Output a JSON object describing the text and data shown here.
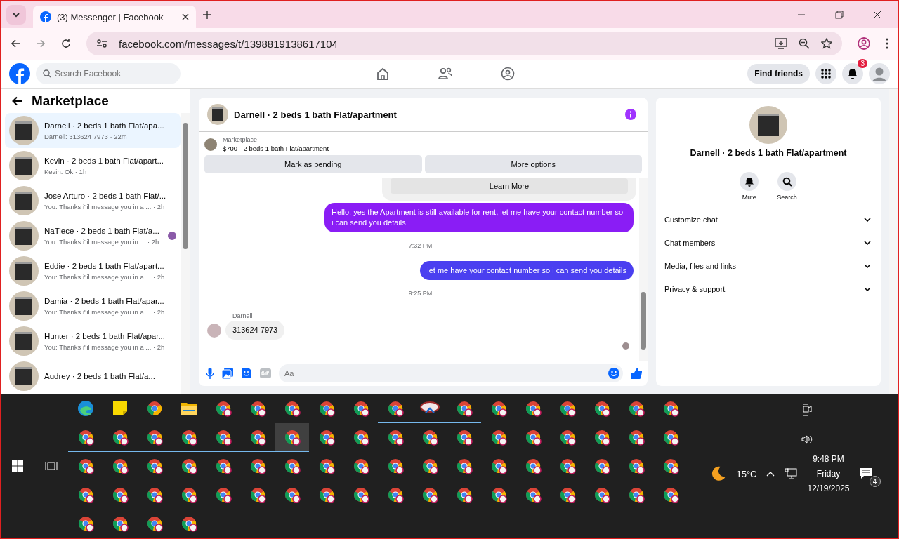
{
  "browser": {
    "tab_title": "(3) Messenger | Facebook",
    "address": "facebook.com/messages/t/1398819138617104"
  },
  "facebook_header": {
    "search_placeholder": "Search Facebook",
    "find_friends": "Find friends",
    "notification_count": "3"
  },
  "sidebar": {
    "title": "Marketplace",
    "items": [
      {
        "title": "Darnell · 2 beds 1 bath Flat/apa...",
        "preview": "Darnell: 313624 7973 · 22m",
        "selected": true,
        "seen": false
      },
      {
        "title": "Kevin · 2 beds 1 bath Flat/apart...",
        "preview": "Kevin: Ok · 1h",
        "selected": false,
        "seen": false
      },
      {
        "title": "Jose Arturo · 2 beds 1 bath Flat/...",
        "preview": "You: Thanks i\"il message you in a ...  · 2h",
        "selected": false,
        "seen": false
      },
      {
        "title": "NaTiece · 2 beds 1 bath Flat/a...",
        "preview": "You: Thanks i\"il message you in ... · 2h",
        "selected": false,
        "seen": true
      },
      {
        "title": "Eddie · 2 beds 1 bath Flat/apart...",
        "preview": "You: Thanks i\"il message you in a ...  · 2h",
        "selected": false,
        "seen": false
      },
      {
        "title": "Damia · 2 beds 1 bath Flat/apar...",
        "preview": "You: Thanks i\"il message you in a ...  · 2h",
        "selected": false,
        "seen": false
      },
      {
        "title": "Hunter · 2 beds 1 bath Flat/apar...",
        "preview": "You: Thanks i\"il message you in a ...  · 2h",
        "selected": false,
        "seen": false
      },
      {
        "title": "Audrey · 2 beds 1 bath Flat/a...",
        "selected": false,
        "seen": false
      }
    ]
  },
  "chat": {
    "title": "Darnell · 2 beds 1 bath Flat/apartment",
    "listing_label": "Marketplace",
    "listing_title": "$700 - 2 beds 1 bath Flat/apartment",
    "actions": [
      "Mark as pending",
      "More options"
    ],
    "messages": [
      {
        "kind": "card_button",
        "text": "Learn More"
      },
      {
        "kind": "outgoing",
        "text": "Hello, yes the Apartment is still available for rent, let me have your contact number so i can send you details",
        "color": "#8a1df5"
      },
      {
        "kind": "timestamp",
        "text": "7:32 PM"
      },
      {
        "kind": "outgoing",
        "text": "let me have your contact number so i can send you details",
        "color": "#4a3ff0"
      },
      {
        "kind": "timestamp",
        "text": "9:25 PM"
      },
      {
        "kind": "incoming",
        "sender": "Darnell",
        "text": "313624 7973"
      }
    ],
    "composer_placeholder": "Aa"
  },
  "details": {
    "title": "Darnell · 2 beds 1 bath Flat/apartment",
    "actions": [
      "Mute",
      "Search"
    ],
    "sections": [
      "Customize chat",
      "Chat members",
      "Media, files and links",
      "Privacy & support"
    ]
  },
  "taskbar": {
    "apps": [
      {
        "kind": "edge",
        "running": false,
        "selected": false
      },
      {
        "kind": "sticky",
        "running": false,
        "selected": false
      },
      {
        "kind": "chrome",
        "running": false,
        "selected": false
      },
      {
        "kind": "explorer",
        "running": false,
        "selected": false
      },
      {
        "kind": "profile",
        "running": false,
        "selected": false
      },
      {
        "kind": "profile",
        "running": false,
        "selected": false
      },
      {
        "kind": "profile",
        "running": false,
        "selected": false
      },
      {
        "kind": "profile",
        "running": false,
        "selected": false
      },
      {
        "kind": "profile",
        "running": false,
        "selected": false
      },
      {
        "kind": "profile",
        "running": true,
        "selected": false
      },
      {
        "kind": "app",
        "running": true,
        "selected": false
      },
      {
        "kind": "profile",
        "running": true,
        "selected": false
      },
      {
        "kind": "profile",
        "running": false,
        "selected": false
      },
      {
        "kind": "profile",
        "running": false,
        "selected": false
      },
      {
        "kind": "profile",
        "running": false,
        "selected": false
      },
      {
        "kind": "profile",
        "running": false,
        "selected": false
      },
      {
        "kind": "profile",
        "running": false,
        "selected": false
      },
      {
        "kind": "profile",
        "running": false,
        "selected": false
      },
      {
        "kind": "profile",
        "running": true,
        "selected": false
      },
      {
        "kind": "profile",
        "running": true,
        "selected": false
      },
      {
        "kind": "profile",
        "running": true,
        "selected": false
      },
      {
        "kind": "profile",
        "running": true,
        "selected": false
      },
      {
        "kind": "profile",
        "running": true,
        "selected": false
      },
      {
        "kind": "profile",
        "running": true,
        "selected": false
      },
      {
        "kind": "profile",
        "running": true,
        "selected": true
      },
      {
        "kind": "profile",
        "running": false,
        "selected": false
      },
      {
        "kind": "profile",
        "running": false,
        "selected": false
      },
      {
        "kind": "profile",
        "running": false,
        "selected": false
      },
      {
        "kind": "profile",
        "running": false,
        "selected": false
      },
      {
        "kind": "profile",
        "running": false,
        "selected": false
      },
      {
        "kind": "profile",
        "running": false,
        "selected": false
      },
      {
        "kind": "profile",
        "running": false,
        "selected": false
      },
      {
        "kind": "profile",
        "running": false,
        "selected": false
      },
      {
        "kind": "profile",
        "running": false,
        "selected": false
      },
      {
        "kind": "profile",
        "running": false,
        "selected": false
      },
      {
        "kind": "profile",
        "running": false,
        "selected": false
      },
      {
        "kind": "profile",
        "running": false,
        "selected": false
      },
      {
        "kind": "profile",
        "running": false,
        "selected": false
      },
      {
        "kind": "profile",
        "running": false,
        "selected": false
      },
      {
        "kind": "profile",
        "running": false,
        "selected": false
      },
      {
        "kind": "profile",
        "running": false,
        "selected": false
      },
      {
        "kind": "profile",
        "running": false,
        "selected": false
      },
      {
        "kind": "profile",
        "running": false,
        "selected": false
      },
      {
        "kind": "profile",
        "running": false,
        "selected": false
      },
      {
        "kind": "profile",
        "running": false,
        "selected": false
      },
      {
        "kind": "profile",
        "running": false,
        "selected": false
      },
      {
        "kind": "profile",
        "running": false,
        "selected": false
      },
      {
        "kind": "profile",
        "running": false,
        "selected": false
      },
      {
        "kind": "profile",
        "running": false,
        "selected": false
      },
      {
        "kind": "profile",
        "running": false,
        "selected": false
      },
      {
        "kind": "profile",
        "running": false,
        "selected": false
      },
      {
        "kind": "profile",
        "running": false,
        "selected": false
      },
      {
        "kind": "profile",
        "running": false,
        "selected": false
      },
      {
        "kind": "profile",
        "running": false,
        "selected": false
      },
      {
        "kind": "profile",
        "running": false,
        "selected": false
      },
      {
        "kind": "profile",
        "running": false,
        "selected": false
      },
      {
        "kind": "profile",
        "running": false,
        "selected": false
      },
      {
        "kind": "profile",
        "running": false,
        "selected": false
      },
      {
        "kind": "profile",
        "running": false,
        "selected": false
      },
      {
        "kind": "profile",
        "running": false,
        "selected": false
      },
      {
        "kind": "profile",
        "running": false,
        "selected": false
      },
      {
        "kind": "profile",
        "running": false,
        "selected": false
      },
      {
        "kind": "profile",
        "running": false,
        "selected": false
      },
      {
        "kind": "profile",
        "running": false,
        "selected": false
      },
      {
        "kind": "profile",
        "running": false,
        "selected": false
      },
      {
        "kind": "profile",
        "running": false,
        "selected": false
      },
      {
        "kind": "profile",
        "running": false,
        "selected": false
      },
      {
        "kind": "profile",
        "running": false,
        "selected": false
      },
      {
        "kind": "profile",
        "running": false,
        "selected": false
      },
      {
        "kind": "profile",
        "running": false,
        "selected": false
      },
      {
        "kind": "profile",
        "running": false,
        "selected": false
      },
      {
        "kind": "profile",
        "running": false,
        "selected": false
      },
      {
        "kind": "profile",
        "running": false,
        "selected": false
      },
      {
        "kind": "profile",
        "running": false,
        "selected": false
      },
      {
        "kind": "profile",
        "running": false,
        "selected": false
      },
      {
        "kind": "profile",
        "running": false,
        "selected": false
      }
    ],
    "temperature": "15°C",
    "time": "9:48 PM",
    "day": "Friday",
    "date": "12/19/2025",
    "notification_count": "4"
  }
}
